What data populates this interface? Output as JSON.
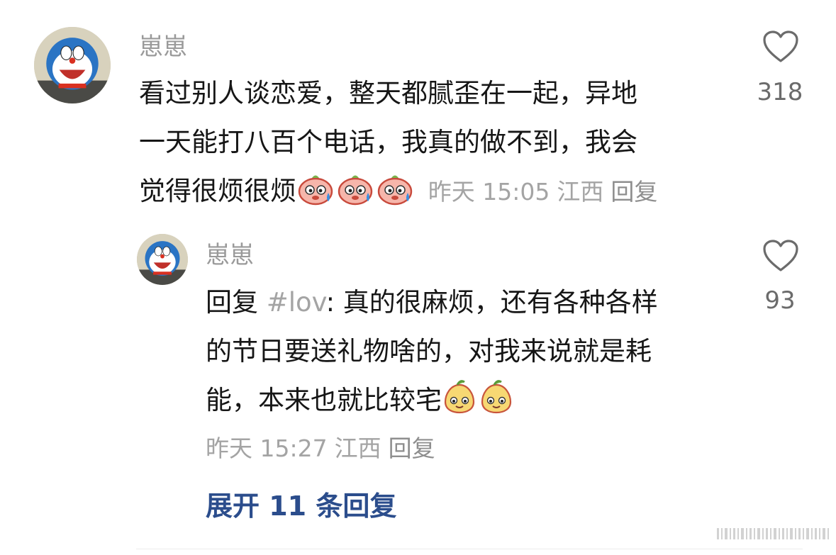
{
  "comment": {
    "username": "崽崽",
    "text_lines": [
      "看过别人谈恋爱，整天都腻歪在一起，异地",
      "一天能打八百个电话，我真的做不到，我会",
      "觉得很烦很烦"
    ],
    "emojis": [
      "sweat-pig-emoji",
      "sweat-pig-emoji",
      "sweat-pig-emoji"
    ],
    "time": "昨天 15:05",
    "location": "江西",
    "reply_label": "回复",
    "like_count": "318"
  },
  "reply": {
    "username": "崽崽",
    "reply_prefix": "回复",
    "mention": "#lov",
    "text_line1": ": 真的很麻烦，还有各种各样",
    "text_lines": [
      "的节日要送礼物啥的，对我来说就是耗",
      "能，本来也就比较宅"
    ],
    "emojis": [
      "smug-pear-emoji",
      "smug-pear-emoji"
    ],
    "time": "昨天 15:27",
    "location": "江西",
    "reply_label": "回复",
    "like_count": "93"
  },
  "expand_label": "展开 11 条回复",
  "colors": {
    "link_blue": "#2b4d8c",
    "meta_gray": "#a4a4a4"
  }
}
